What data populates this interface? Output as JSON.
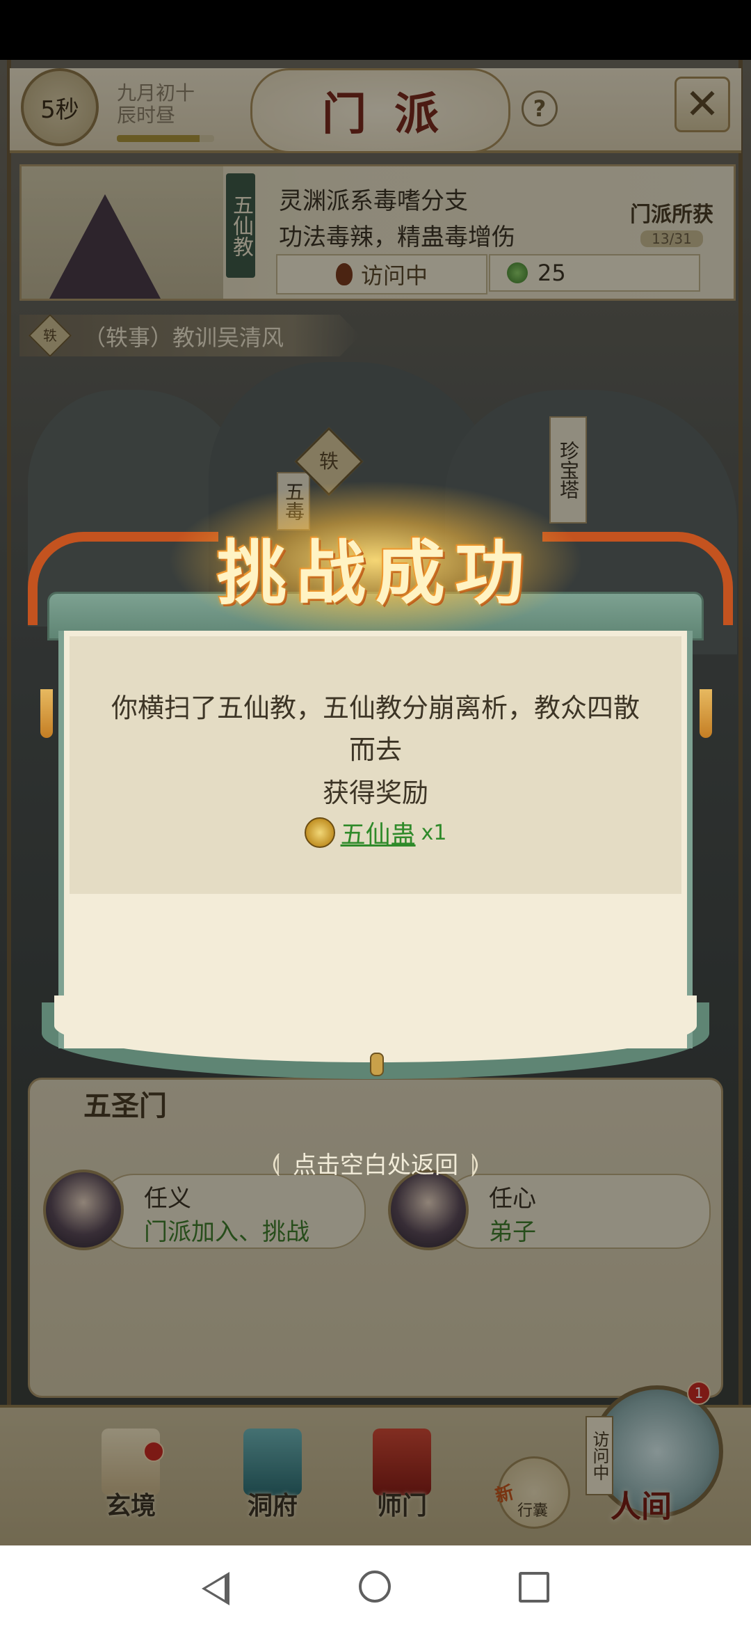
{
  "header": {
    "timer": "5秒",
    "date_line1": "九月初十",
    "date_line2": "辰时昼",
    "title": "门派",
    "help_label": "?",
    "close_label": "✕"
  },
  "sect": {
    "name_vertical": "五仙教",
    "desc_line1": "灵渊派系毒嗜分支",
    "desc_line2": "功法毒辣，精蛊毒增伤",
    "visit_status": "访问中",
    "jade_count": "25",
    "obtained_label": "门派所获",
    "obtained_count": "13/31"
  },
  "quest": {
    "icon_char": "轶",
    "text": "（轶事）教训吴清风"
  },
  "map": {
    "tower_label": "珍宝塔",
    "five_label": "五毒",
    "quest_icon_char": "轶"
  },
  "dialog": {
    "title": "挑战成功",
    "message_line1": "你横扫了五仙教，五仙教分崩离析，教众四散",
    "message_line2": "而去",
    "reward_title": "获得奖励",
    "reward_name": "五仙蛊",
    "reward_qty": "x1"
  },
  "hint": {
    "text": "点击空白处返回",
    "swirl_left": "⟬",
    "swirl_right": "⟭"
  },
  "subsect": {
    "title": "五圣门",
    "npcs": [
      {
        "name": "任义",
        "role": "门派加入、挑战"
      },
      {
        "name": "任心",
        "role": "弟子"
      }
    ]
  },
  "nav": {
    "items": [
      {
        "label": "玄境"
      },
      {
        "label": "洞府"
      },
      {
        "label": "师门"
      }
    ],
    "bag_new": "新",
    "bag_label": "行囊",
    "visiting_tag": "访问中",
    "world_label": "人间",
    "world_badge": "1"
  },
  "colors": {
    "reward_green": "#2f8a2a",
    "title_red": "#7a2a1e",
    "ribbon": "#c4531f",
    "scroll_green": "#5f8574"
  }
}
